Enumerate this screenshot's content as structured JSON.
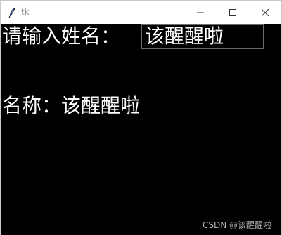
{
  "window": {
    "title": "tk"
  },
  "titlebar_icons": {
    "app": "feather-icon",
    "minimize": "minimize-icon",
    "maximize": "maximize-icon",
    "close": "close-icon"
  },
  "form": {
    "prompt_label": "请输入姓名：",
    "name_value": "该醒醒啦",
    "result_label": "名称：该醒醒啦"
  },
  "watermark": "CSDN @该醒醒啦",
  "colors": {
    "client_background": "#000000",
    "text": "#ffffff",
    "titlebar_background": "#ffffff",
    "title_text": "#9a9a9a"
  }
}
